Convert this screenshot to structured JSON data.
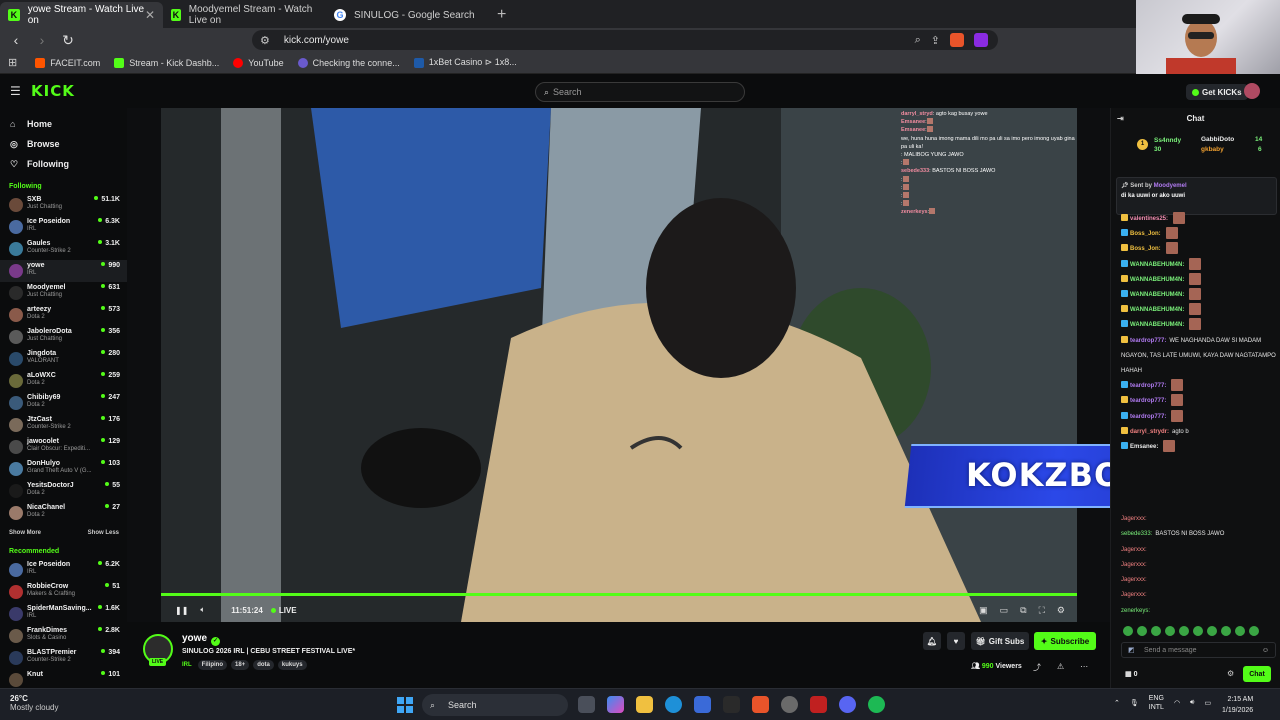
{
  "browser": {
    "tabs": [
      {
        "label": "yowe Stream - Watch Live on",
        "icon": "kick-favicon",
        "active": true
      },
      {
        "label": "Moodyemel Stream - Watch Live on",
        "icon": "kick-favicon",
        "active": false
      },
      {
        "label": "SINULOG - Google Search",
        "icon": "google-favicon",
        "active": false
      }
    ],
    "url": "kick.com/yowe",
    "bookmarks": [
      "FACEIT.com",
      "Stream - Kick Dashb...",
      "YouTube",
      "Checking the conne...",
      "1xBet Casino ⊳ 1x8..."
    ]
  },
  "kick": {
    "logo": "KICK",
    "search_placeholder": "Search",
    "get_kicks": "Get KICKs"
  },
  "sidebar": {
    "nav": [
      {
        "label": "Home",
        "icon": "home-icon"
      },
      {
        "label": "Browse",
        "icon": "compass-icon"
      },
      {
        "label": "Following",
        "icon": "heart-icon"
      }
    ],
    "following_title": "Following",
    "following": [
      {
        "name": "SXB",
        "category": "Just Chatting",
        "viewers": "51.1K",
        "color": "#6a4a3a"
      },
      {
        "name": "Ice Poseidon",
        "category": "IRL",
        "viewers": "6.3K",
        "color": "#4a6aa0"
      },
      {
        "name": "Gaules",
        "category": "Counter-Strike 2",
        "viewers": "3.1K",
        "color": "#3a7a9a"
      },
      {
        "name": "yowe",
        "category": "IRL",
        "viewers": "990",
        "color": "#7a3a8a"
      },
      {
        "name": "Moodyemel",
        "category": "Just Chatting",
        "viewers": "631",
        "color": "#2a2a2a"
      },
      {
        "name": "arteezy",
        "category": "Dota 2",
        "viewers": "573",
        "color": "#8a5a4a"
      },
      {
        "name": "JaboleroDota",
        "category": "Just Chatting",
        "viewers": "356",
        "color": "#5a5a5a"
      },
      {
        "name": "Jingdota",
        "category": "VALORANT",
        "viewers": "280",
        "color": "#2a4a6a"
      },
      {
        "name": "aLoWXC",
        "category": "Dota 2",
        "viewers": "259",
        "color": "#6a6a3a"
      },
      {
        "name": "Chibiby69",
        "category": "Dota 2",
        "viewers": "247",
        "color": "#3a5a7a"
      },
      {
        "name": "JtzCast",
        "category": "Counter-Strike 2",
        "viewers": "176",
        "color": "#7a6a5a"
      },
      {
        "name": "jawocolet",
        "category": "Clair Obscur: Expediti...",
        "viewers": "129",
        "color": "#4a4a4a"
      },
      {
        "name": "DonHulyo",
        "category": "Grand Theft Auto V (G...",
        "viewers": "103",
        "color": "#4a7aa0"
      },
      {
        "name": "YesitsDoctorJ",
        "category": "Dota 2",
        "viewers": "55",
        "color": "#1a1a1a"
      },
      {
        "name": "NicaChanel",
        "category": "Dota 2",
        "viewers": "27",
        "color": "#9a7a6a"
      }
    ],
    "show_more": "Show More",
    "show_less": "Show Less",
    "recommended_title": "Recommended",
    "recommended": [
      {
        "name": "Ice Poseidon",
        "category": "IRL",
        "viewers": "6.2K",
        "color": "#4a6aa0"
      },
      {
        "name": "RobbieCrow",
        "category": "Makers & Crafting",
        "viewers": "51",
        "color": "#b03030"
      },
      {
        "name": "SpiderManSaving...",
        "category": "IRL",
        "viewers": "1.6K",
        "color": "#3a3a6a"
      },
      {
        "name": "FrankDimes",
        "category": "Slots & Casino",
        "viewers": "2.8K",
        "color": "#6a5a4a"
      },
      {
        "name": "BLASTPremier",
        "category": "Counter-Strike 2",
        "viewers": "394",
        "color": "#2a3a5a"
      },
      {
        "name": "Knut",
        "category": "",
        "viewers": "101",
        "color": "#5a4a3a"
      }
    ]
  },
  "video": {
    "time": "11:51:24",
    "live": "LIVE",
    "overlay_banner": "KOKZBONUS",
    "overlay_chat": [
      {
        "user": "darryl_stryd",
        "msg": ": agto kag busay yowe"
      },
      {
        "user": "Emsanee",
        "msg": ":"
      },
      {
        "user": "Emsanee",
        "msg": ":"
      },
      {
        "user": "",
        "msg": "we, huna huna imong mama dili mo pa uli sa imo pero imong uyab gina pa uli ka!"
      },
      {
        "user": "",
        "msg": ": MALIBOG YUNG JAWO"
      },
      {
        "user": "",
        "msg": ":"
      },
      {
        "user": "sebede333",
        "msg": ": BASTOS NI BOSS JAWO"
      },
      {
        "user": "",
        "msg": ":"
      },
      {
        "user": "",
        "msg": ":"
      },
      {
        "user": "",
        "msg": ":"
      },
      {
        "user": "",
        "msg": ":"
      },
      {
        "user": "zenerkeys",
        "msg": ":"
      }
    ]
  },
  "stream": {
    "name": "yowe",
    "live_badge": "LIVE",
    "title": "SINULOG 2026 IRL | CEBU STREET FESTIVAL LIVE*",
    "category": "IRL",
    "tags": [
      "Filipino",
      "18+",
      "dota",
      "kukuys"
    ],
    "gift_subs": "Gift Subs",
    "subscribe": "Subscribe",
    "viewers": "990",
    "viewers_label": "Viewers"
  },
  "chat": {
    "title": "Chat",
    "top_gifters": [
      {
        "name": "Ss4nndy",
        "count": "30",
        "rank": "1"
      },
      {
        "name": "GabbiDoto",
        "count": "14"
      },
      {
        "name": "gkbaby",
        "count": "6"
      }
    ],
    "pinned_by": "Sent by",
    "pinned_user": "Moodyemel",
    "pinned_msg": "di ka uuwi or ako uuwi",
    "messages": [
      {
        "user": "valentines25:",
        "msg": "",
        "color": "#f08cb0"
      },
      {
        "user": "Boss_Jon:",
        "msg": "",
        "color": "#f0c040"
      },
      {
        "user": "Boss_Jon:",
        "msg": "",
        "color": "#f0c040"
      },
      {
        "user": "WANNABEHUM4N:",
        "msg": "",
        "color": "#7af07a"
      },
      {
        "user": "WANNABEHUM4N:",
        "msg": "",
        "color": "#7af07a"
      },
      {
        "user": "WANNABEHUM4N:",
        "msg": "",
        "color": "#7af07a"
      },
      {
        "user": "WANNABEHUM4N:",
        "msg": "",
        "color": "#7af07a"
      },
      {
        "user": "WANNABEHUM4N:",
        "msg": "",
        "color": "#7af07a"
      },
      {
        "user": "teardrop777:",
        "msg": "WE NAGHANDA DAW SI MADAM NGAYON, TAS LATE UMUWI, KAYA DAW NAGTATAMPO HAHAH",
        "color": "#b07af0"
      },
      {
        "user": "teardrop777:",
        "msg": "",
        "color": "#b07af0"
      },
      {
        "user": "teardrop777:",
        "msg": "",
        "color": "#b07af0"
      },
      {
        "user": "teardrop777:",
        "msg": "",
        "color": "#b07af0"
      },
      {
        "user": "darryl_strydr:",
        "msg": "agto b",
        "color": "#f08080"
      },
      {
        "user": "Emsanee:",
        "msg": "",
        "color": "#eaeaea"
      }
    ],
    "messages_lower": [
      {
        "user": "Jagerxxx:",
        "msg": "",
        "color": "#f08080"
      },
      {
        "user": "sebede333:",
        "msg": "BASTOS NI BOSS JAWO",
        "color": "#7af07a"
      },
      {
        "user": "Jagerxxx:",
        "msg": "",
        "color": "#f08080"
      },
      {
        "user": "Jagerxxx:",
        "msg": "",
        "color": "#f08080"
      },
      {
        "user": "Jagerxxx:",
        "msg": "",
        "color": "#f08080"
      },
      {
        "user": "Jagerxxx:",
        "msg": "",
        "color": "#f08080"
      },
      {
        "user": "zenerkeys:",
        "msg": "",
        "color": "#7af07a"
      }
    ],
    "input_placeholder": "Send a message",
    "count": "0",
    "send_button": "Chat"
  },
  "taskbar": {
    "temp": "26°C",
    "weather": "Mostly cloudy",
    "search": "Search",
    "lang": "ENG",
    "lang_sub": "INTL",
    "time": "2:15 AM",
    "date": "1/19/2026"
  }
}
